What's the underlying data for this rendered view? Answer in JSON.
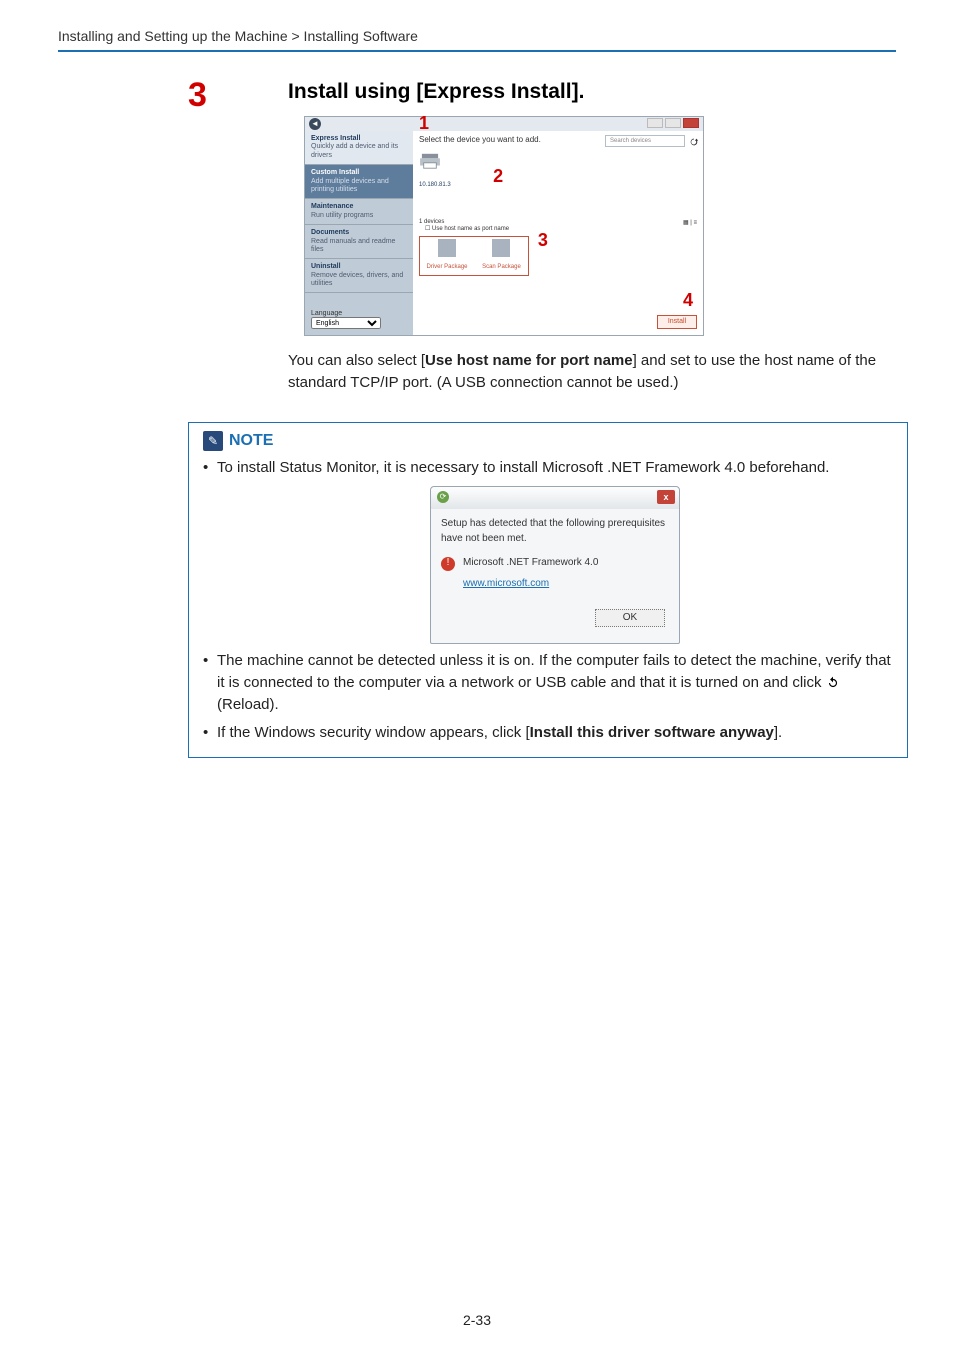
{
  "breadcrumb": "Installing and Setting up the Machine > Installing Software",
  "step_number": "3",
  "heading": "Install using [Express Install].",
  "installer": {
    "nums": {
      "one": "1",
      "two": "2",
      "three": "3",
      "four": "4"
    },
    "side": [
      {
        "t": "Express Install",
        "d": "Quickly add a device and its drivers"
      },
      {
        "t": "Custom Install",
        "d": "Add multiple devices and printing utilities"
      },
      {
        "t": "Maintenance",
        "d": "Run utility programs"
      },
      {
        "t": "Documents",
        "d": "Read manuals and readme files"
      },
      {
        "t": "Uninstall",
        "d": "Remove devices, drivers, and utilities"
      }
    ],
    "select_text": "Select the device you want to add.",
    "search_placeholder": "Search devices",
    "printer_ip": "10.180.81.3",
    "devices_count": "1 devices",
    "hostname_check": "Use host name as port name",
    "pkg1": "Driver Package",
    "pkg2": "Scan Package",
    "install_btn": "Install",
    "language_label": "Language",
    "language_value": "English"
  },
  "paragraph1_a": "You can also select [",
  "paragraph1_bold": "Use host name for port name",
  "paragraph1_b": "] and set to use the host name of the standard TCP/IP port. (A USB connection cannot be used.)",
  "note": {
    "title": "NOTE",
    "li1": "To install Status Monitor, it is necessary to install Microsoft .NET Framework 4.0 beforehand.",
    "prereq_msg": "Setup has detected that the following prerequisites have not been met.",
    "prereq_item": "Microsoft .NET Framework 4.0",
    "prereq_link": "www.microsoft.com",
    "ok": "OK",
    "li2_a": "The machine cannot be detected unless it is on. If the computer fails to detect the machine, verify that it is connected to the computer via a network or USB cable and that it is turned on and click ",
    "li2_b": " (Reload).",
    "li3_a": "If the Windows security window appears, click [",
    "li3_bold": "Install this driver software anyway",
    "li3_b": "]."
  },
  "page_number": "2-33"
}
